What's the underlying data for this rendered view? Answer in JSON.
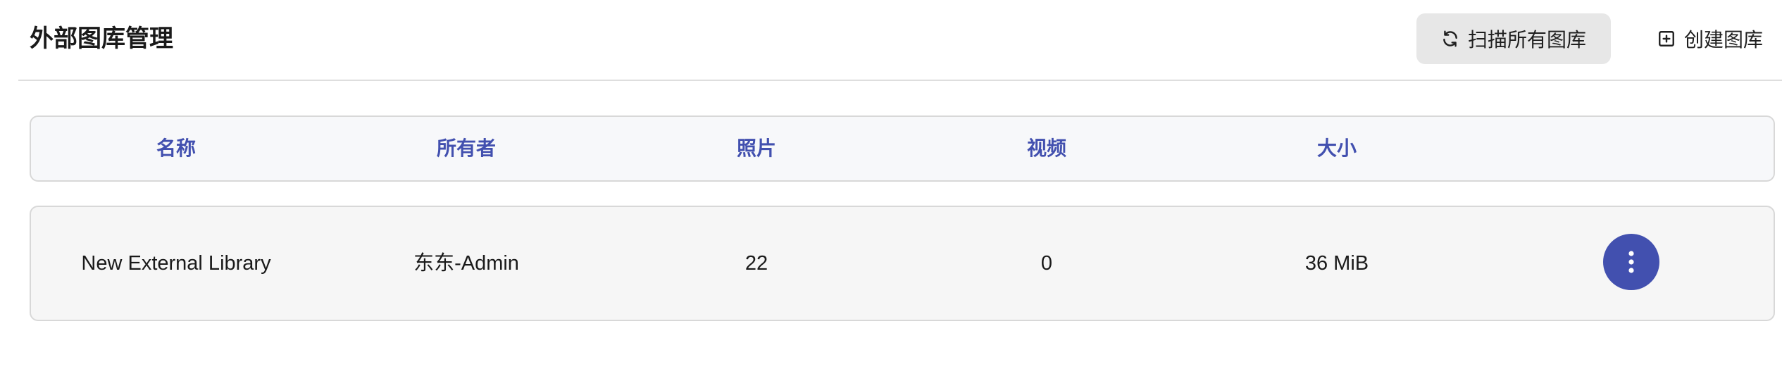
{
  "header": {
    "title": "外部图库管理",
    "scan_all_label": "扫描所有图库",
    "create_label": "创建图库"
  },
  "table": {
    "columns": [
      "名称",
      "所有者",
      "照片",
      "视频",
      "大小"
    ],
    "rows": [
      {
        "name": "New External Library",
        "owner": "东东-Admin",
        "photos": "22",
        "videos": "0",
        "size": "36 MiB"
      }
    ]
  },
  "icons": {
    "scan": "refresh-icon",
    "create": "plus-square-icon",
    "menu": "more-vertical-icon"
  },
  "colors": {
    "accent": "#4250af",
    "header_bg": "#f7f8fa",
    "row_bg": "#f6f6f6",
    "button_bg": "#e7e7e7"
  }
}
